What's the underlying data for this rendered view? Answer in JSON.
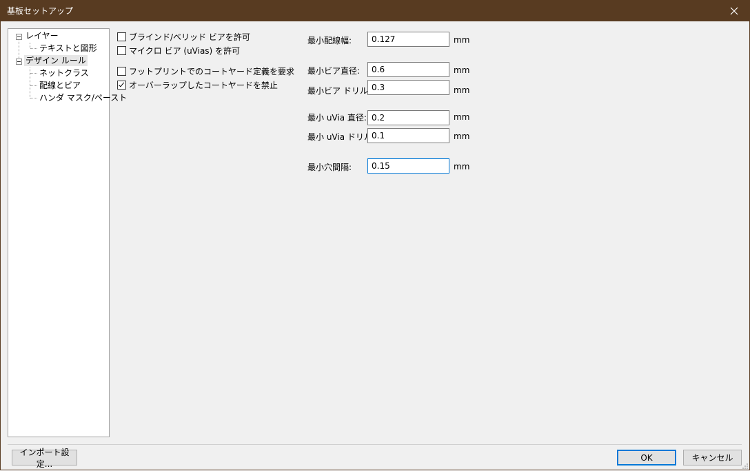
{
  "window": {
    "title": "基板セットアップ",
    "close_icon": "close-icon"
  },
  "tree": {
    "groups": [
      {
        "label": "レイヤー",
        "children": [
          "テキストと図形"
        ]
      },
      {
        "label": "デザイン ルール",
        "children": [
          "ネットクラス",
          "配線とビア",
          "ハンダ マスク/ペースト"
        ]
      }
    ],
    "selected": "デザイン ルール"
  },
  "options": [
    {
      "label": "ブラインド/ベリッド ビアを許可",
      "checked": false
    },
    {
      "label": "マイクロ ビア (uVias) を許可",
      "checked": false
    },
    {
      "label": "フットプリントでのコートヤード定義を要求",
      "checked": false
    },
    {
      "label": "オーバーラップしたコートヤードを禁止",
      "checked": true
    }
  ],
  "fields": [
    {
      "label": "最小配線幅:",
      "value": "0.127",
      "unit": "mm"
    },
    {
      "label": "最小ビア直径:",
      "value": "0.6",
      "unit": "mm"
    },
    {
      "label": "最小ビア ドリル:",
      "value": "0.3",
      "unit": "mm"
    },
    {
      "label": "最小 uVia 直径:",
      "value": "0.2",
      "unit": "mm"
    },
    {
      "label": "最小 uVia ドリル:",
      "value": "0.1",
      "unit": "mm"
    },
    {
      "label": "最小穴間隔:",
      "value": "0.15",
      "unit": "mm"
    }
  ],
  "buttons": {
    "import": "インポート設定...",
    "ok": "OK",
    "cancel": "キャンセル"
  },
  "colors": {
    "titlebar": "#583b21",
    "focus": "#0078d7"
  }
}
